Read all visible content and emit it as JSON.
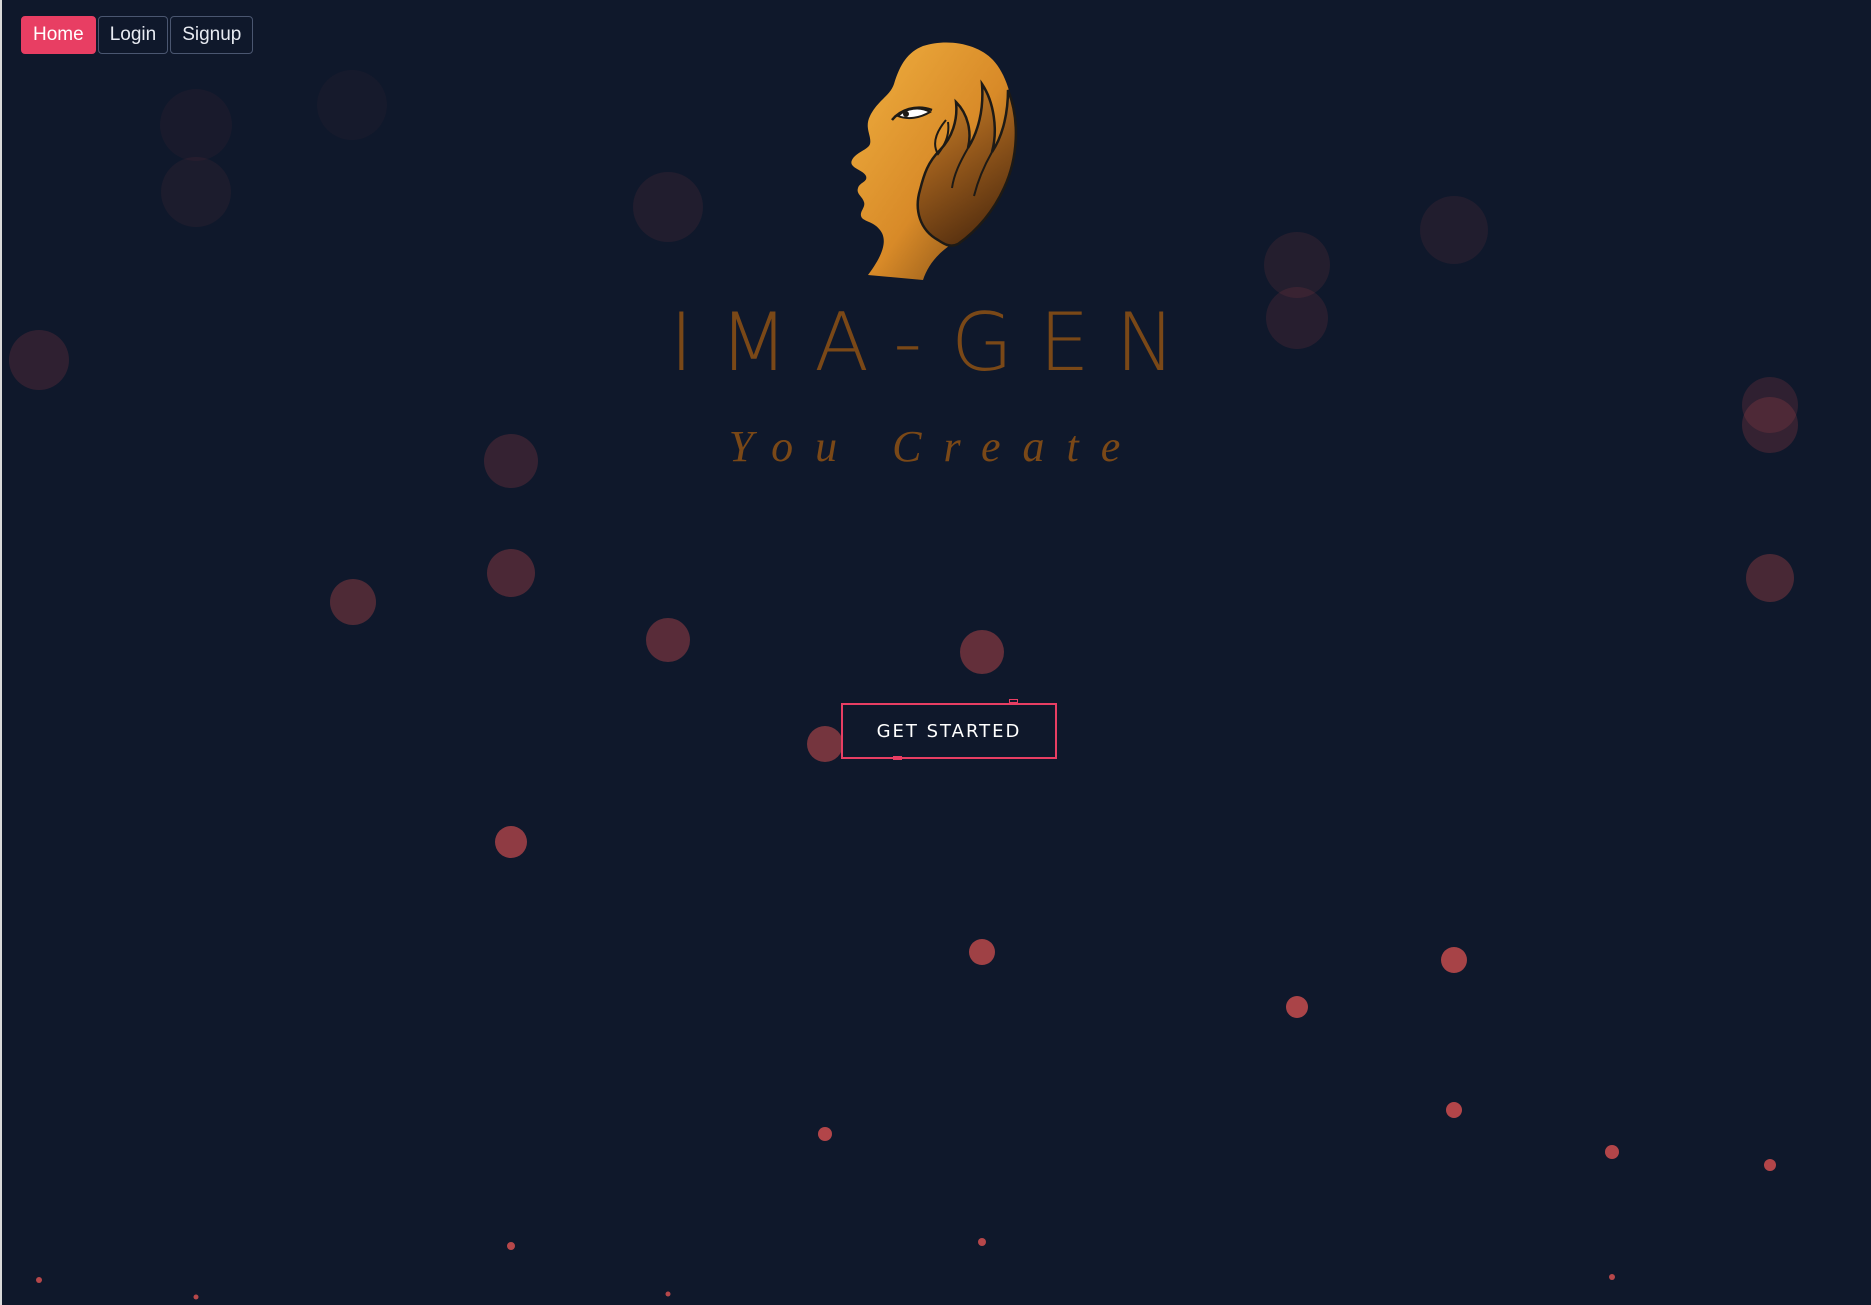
{
  "nav": {
    "items": [
      {
        "label": "Home",
        "active": true
      },
      {
        "label": "Login",
        "active": false
      },
      {
        "label": "Signup",
        "active": false
      }
    ]
  },
  "brand": {
    "logo_icon": "golden-head-with-hand-icon",
    "title": "IMA-GEN",
    "tagline": "You Create"
  },
  "cta": {
    "label": "GET STARTED"
  },
  "colors": {
    "background": "#0f182b",
    "accent": "#e83e63",
    "brand_text": "#7a4817",
    "particle": "#c04a4c"
  }
}
